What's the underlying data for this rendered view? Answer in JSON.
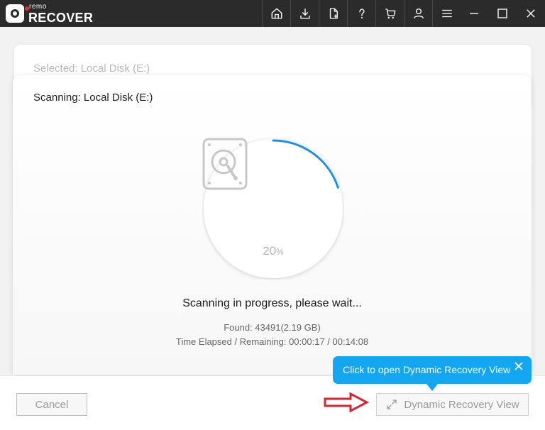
{
  "app": {
    "brand_small": "remo",
    "brand_big": "RECOVER"
  },
  "titlebar": {
    "icons": [
      "home-icon",
      "download-icon",
      "add-file-icon",
      "help-icon",
      "cart-icon",
      "account-icon",
      "menu-icon"
    ],
    "window_controls": [
      "minimize-icon",
      "maximize-icon",
      "close-icon"
    ]
  },
  "selected": {
    "label": "Selected: Local Disk (E:)"
  },
  "scan": {
    "title": "Scanning: Local Disk (E:)",
    "progress_percent": 20,
    "progress_value": "20",
    "progress_unit": "%",
    "status": "Scanning in progress, please wait...",
    "found": "Found: 43491(2.19 GB)",
    "time": "Time Elapsed / Remaining:  00:00:17 / 00:14:08",
    "progress_color": "#1a8ee8"
  },
  "buttons": {
    "cancel": "Cancel",
    "dynamic_recovery_view": "Dynamic Recovery View"
  },
  "tooltip": {
    "text": "Click to open Dynamic Recovery View",
    "color": "#14a7f1"
  },
  "annotation": {
    "arrow_color": "#d7262f"
  }
}
